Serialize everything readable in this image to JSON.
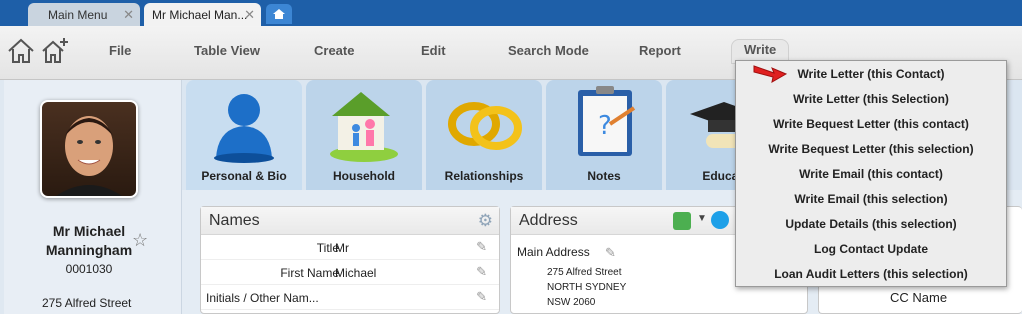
{
  "tabs": [
    {
      "label": "Main Menu"
    },
    {
      "label": "Mr Michael Man..."
    }
  ],
  "tab_close_glyph": "✕",
  "menu": {
    "file": "File",
    "table_view": "Table View",
    "create": "Create",
    "edit": "Edit",
    "search_mode": "Search Mode",
    "report": "Report",
    "write": "Write"
  },
  "contact": {
    "name_line1": "Mr Michael",
    "name_line2": "Manningham",
    "id": "0001030",
    "address": "275 Alfred Street"
  },
  "icon_tabs": [
    {
      "label": "Personal & Bio",
      "icon": "person-icon"
    },
    {
      "label": "Household",
      "icon": "house-family-icon"
    },
    {
      "label": "Relationships",
      "icon": "rings-icon"
    },
    {
      "label": "Notes",
      "icon": "notes-clipboard-icon"
    },
    {
      "label": "Educati",
      "icon": "graduation-cap-icon"
    }
  ],
  "names_panel": {
    "title": "Names",
    "rows": [
      {
        "label": "Title",
        "value": "Mr"
      },
      {
        "label": "First Name",
        "value": "Michael"
      },
      {
        "label": "Initials / Other Nam...",
        "value": ""
      }
    ]
  },
  "address_panel": {
    "title": "Address",
    "main_label": "Main Address",
    "lines": [
      "275 Alfred Street",
      "NORTH SYDNEY",
      "NSW 2060"
    ]
  },
  "write_menu": {
    "items": [
      "Write Letter (this Contact)",
      "Write Letter (this Selection)",
      "Write Bequest Letter (this contact)",
      "Write Bequest Letter (this selection)",
      "Write Email (this contact)",
      "Write Email (this selection)",
      "Update Details (this selection)",
      "Log Contact Update",
      "Loan Audit Letters (this selection)"
    ]
  },
  "cc_label": "CC Name",
  "colors": {
    "tabstrip": "#1e5fa8",
    "accent_arrow": "#e02020"
  }
}
